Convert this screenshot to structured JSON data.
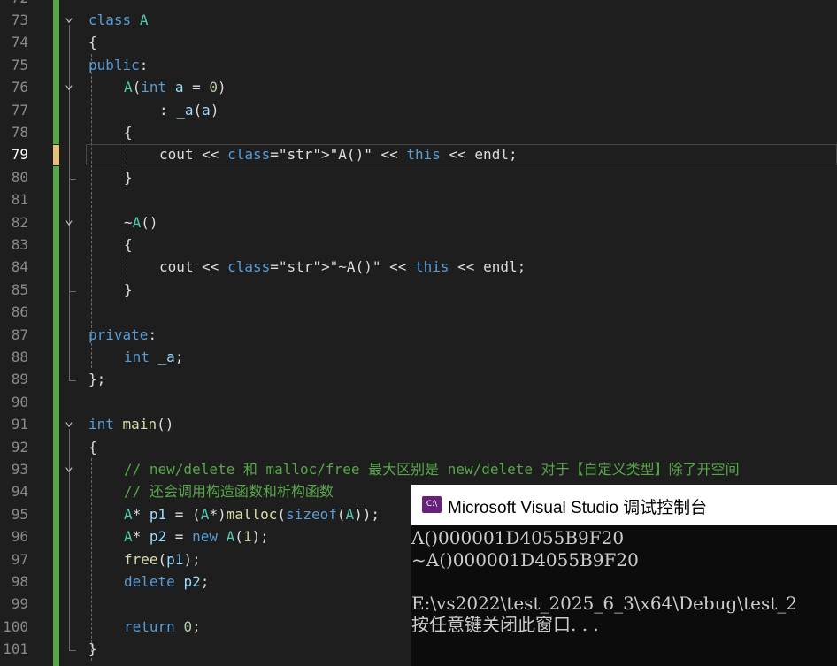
{
  "editor": {
    "top_partial_line": "72",
    "active_line": "79",
    "lines": [
      {
        "n": "73",
        "t": "class A"
      },
      {
        "n": "74",
        "t": "{"
      },
      {
        "n": "75",
        "t": "public:"
      },
      {
        "n": "76",
        "t": "A(int a = 0)"
      },
      {
        "n": "77",
        "t": ": _a(a)"
      },
      {
        "n": "78",
        "t": "{"
      },
      {
        "n": "79",
        "t": "cout << \"A()\" << this << endl;"
      },
      {
        "n": "80",
        "t": "}"
      },
      {
        "n": "81",
        "t": ""
      },
      {
        "n": "82",
        "t": "~A()"
      },
      {
        "n": "83",
        "t": "{"
      },
      {
        "n": "84",
        "t": "cout << \"~A()\" << this << endl;"
      },
      {
        "n": "85",
        "t": "}"
      },
      {
        "n": "86",
        "t": ""
      },
      {
        "n": "87",
        "t": "private:"
      },
      {
        "n": "88",
        "t": "int _a;"
      },
      {
        "n": "89",
        "t": "};"
      },
      {
        "n": "90",
        "t": ""
      },
      {
        "n": "91",
        "t": "int main()"
      },
      {
        "n": "92",
        "t": "{"
      },
      {
        "n": "93",
        "t": "// new/delete 和 malloc/free 最大区别是 new/delete 对于【自定义类型】除了开空间"
      },
      {
        "n": "94",
        "t": "// 还会调用构造函数和析构函数"
      },
      {
        "n": "95",
        "t": "A* p1 = (A*)malloc(sizeof(A));"
      },
      {
        "n": "96",
        "t": "A* p2 = new A(1);"
      },
      {
        "n": "97",
        "t": "free(p1);"
      },
      {
        "n": "98",
        "t": "delete p2;"
      },
      {
        "n": "99",
        "t": ""
      },
      {
        "n": "100",
        "t": "return 0;"
      },
      {
        "n": "101",
        "t": "}"
      }
    ]
  },
  "console": {
    "icon_text": "C:\\",
    "title": "Microsoft Visual Studio 调试控制台",
    "lines": [
      "A()000001D4055B9F20",
      "~A()000001D4055B9F20",
      "",
      "E:\\vs2022\\test_2025_6_3\\x64\\Debug\\test_2",
      "按任意键关闭此窗口. . ."
    ]
  },
  "colors": {
    "editor_bg": "#1e1e1e",
    "keyword": "#569cd6",
    "type": "#4ec9b0",
    "function": "#dcdcaa",
    "number": "#b5cea8",
    "string": "#d69d85",
    "comment": "#57a64a",
    "change_bar": "#57a64a",
    "console_bg": "#0c0c0c",
    "console_icon": "#68217a"
  }
}
